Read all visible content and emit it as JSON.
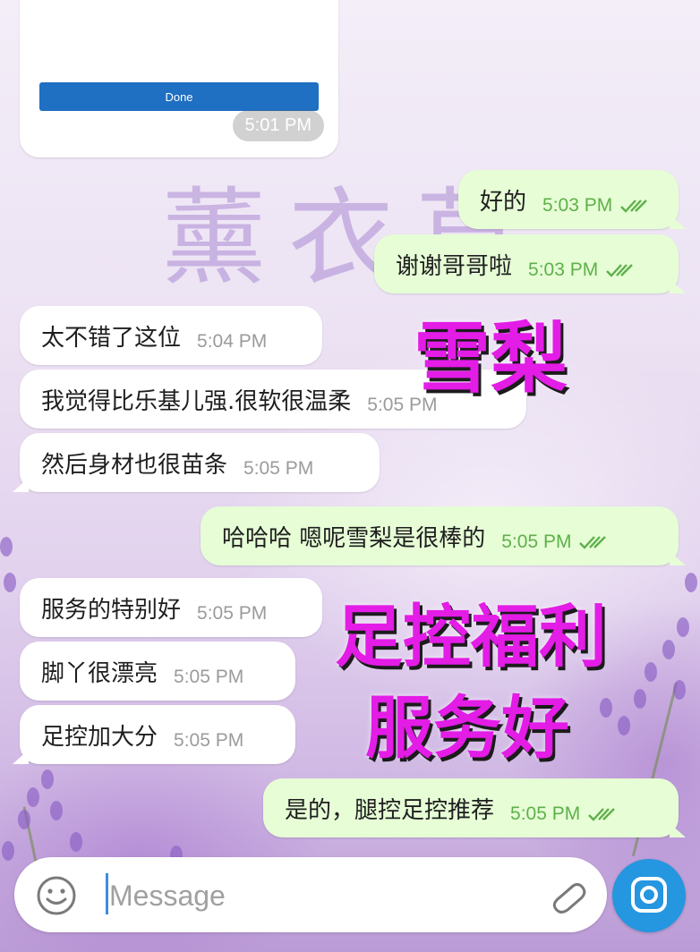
{
  "watermark": "薰衣草",
  "card": {
    "done_label": "Done",
    "time": "5:01 PM"
  },
  "messages": [
    {
      "side": "out",
      "text": "好的",
      "time": "5:03 PM"
    },
    {
      "side": "out",
      "text": "谢谢哥哥啦",
      "time": "5:03 PM"
    },
    {
      "side": "in",
      "text": "太不错了这位",
      "time": "5:04 PM"
    },
    {
      "side": "in",
      "text": "我觉得比乐基儿强.很软很温柔",
      "time": "5:05 PM"
    },
    {
      "side": "in",
      "text": "然后身材也很苗条",
      "time": "5:05 PM"
    },
    {
      "side": "out",
      "text": "哈哈哈 嗯呢雪梨是很棒的",
      "time": "5:05 PM"
    },
    {
      "side": "in",
      "text": "服务的特别好",
      "time": "5:05 PM"
    },
    {
      "side": "in",
      "text": "脚丫很漂亮",
      "time": "5:05 PM"
    },
    {
      "side": "in",
      "text": "足控加大分",
      "time": "5:05 PM"
    },
    {
      "side": "out",
      "text": "是的，腿控足控推荐",
      "time": "5:05 PM"
    }
  ],
  "overlays": [
    "雪梨",
    "足控福利",
    "服务好"
  ],
  "composer": {
    "placeholder": "Message"
  },
  "icons": {
    "emoji": "emoji-icon",
    "attach": "paperclip-icon",
    "camera": "camera-icon",
    "read_receipt": "double-check-icon"
  },
  "colors": {
    "outgoing_bubble": "#e6fdd6",
    "incoming_bubble": "#ffffff",
    "time_outgoing": "#5fb04a",
    "send_button": "#2596e0",
    "promo_text": "#e31ce6"
  }
}
